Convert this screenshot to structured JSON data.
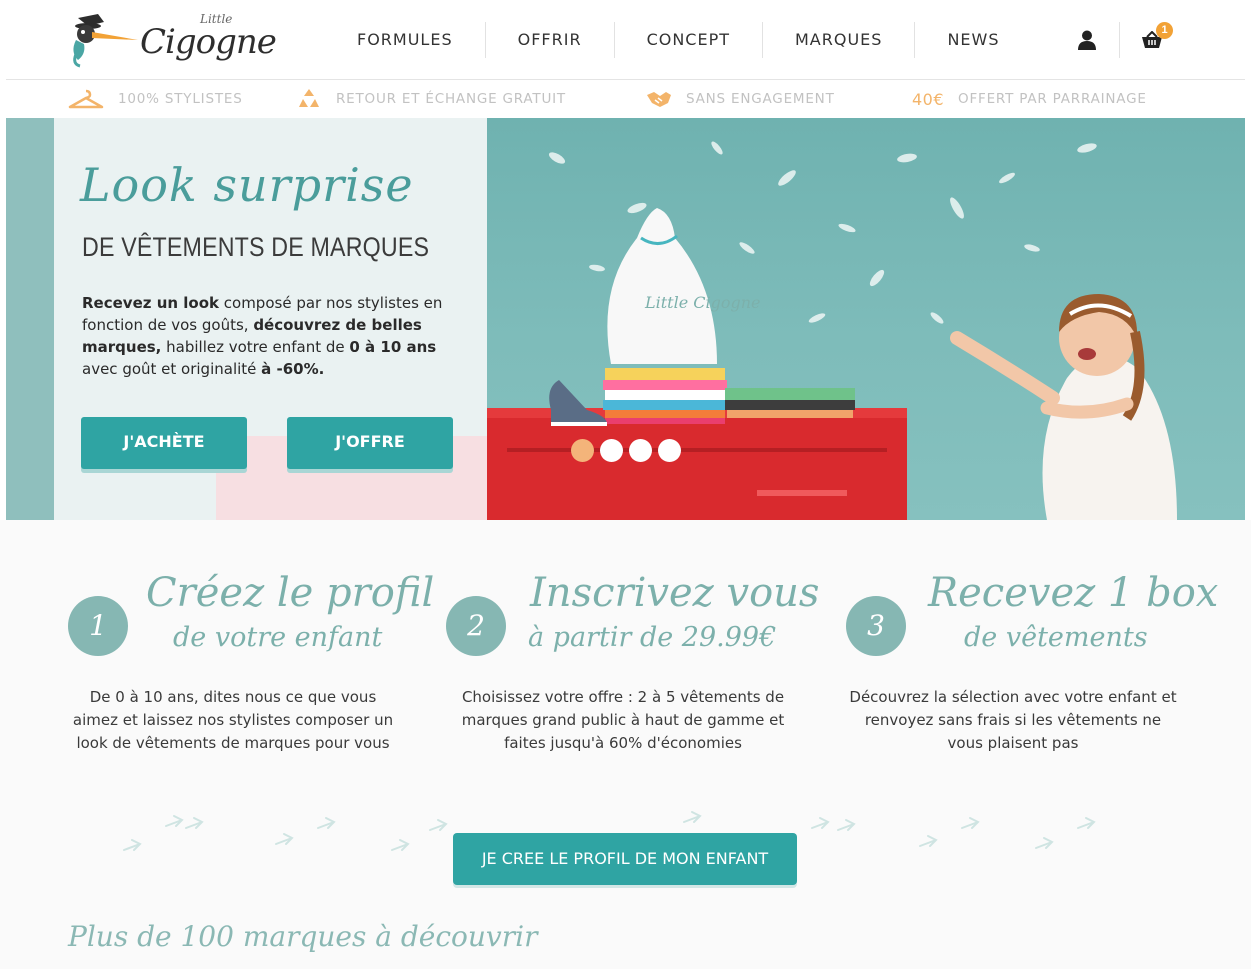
{
  "header": {
    "logo_word": "Cigogne",
    "logo_little": "Little",
    "nav": [
      "FORMULES",
      "OFFRIR",
      "CONCEPT",
      "MARQUES",
      "NEWS"
    ],
    "cart_count": "1"
  },
  "benefits": {
    "stylists": "100% STYLISTES",
    "return": "RETOUR ET ÉCHANGE GRATUIT",
    "no_commitment": "SANS ENGAGEMENT",
    "referral_amount": "40€",
    "referral_text": "OFFERT PAR PARRAINAGE"
  },
  "hero": {
    "script_title": "Look surprise",
    "subtitle": "DE VÊTEMENTS DE MARQUES",
    "desc": {
      "p1": "Recevez un look",
      "p2": " composé par nos stylistes en fonction de vos goûts, ",
      "p3": "découvrez de belles marques,",
      "p4": " habillez votre enfant de ",
      "p5": "0 à 10 ans",
      "p6": " avec goût et originalité ",
      "p7": "à -60%."
    },
    "buy_label": "J'ACHÈTE",
    "offer_label": "J'OFFRE",
    "slides_total": 4,
    "slide_active": 1,
    "bag_text": "Little Cigogne"
  },
  "steps": [
    {
      "number": "1",
      "title_line1": "Créez le profil",
      "title_line2": "de votre enfant",
      "desc": "De 0 à 10 ans, dites nous ce que vous aimez et laissez nos stylistes composer un look de vêtements de marques pour vous"
    },
    {
      "number": "2",
      "title_line1": "Inscrivez vous",
      "title_line2": "à partir de 29.99€",
      "desc": "Choisissez votre offre : 2 à 5 vêtements de marques grand public à haut de gamme et faites jusqu'à 60% d'économies"
    },
    {
      "number": "3",
      "title_line1": "Recevez 1 box",
      "title_line2": "de vêtements",
      "desc": "Découvrez la sélection avec votre enfant et renvoyez sans frais si les vêtements ne vous plaisent pas"
    }
  ],
  "cta_label": "JE CREE LE PROFIL DE MON ENFANT",
  "brands_title": "Plus de 100 marques à découvrir",
  "colors": {
    "teal": "#2fa4a3",
    "sage": "#86b7b3",
    "orange": "#f2a236",
    "hero_bg": "#8fbfbd",
    "red_cabinet": "#d92a2e"
  },
  "icons": {
    "account": "user-icon",
    "cart": "basket-icon",
    "stylists": "hanger-icon",
    "return": "recycle-icon",
    "no_commitment": "handshake-icon"
  }
}
